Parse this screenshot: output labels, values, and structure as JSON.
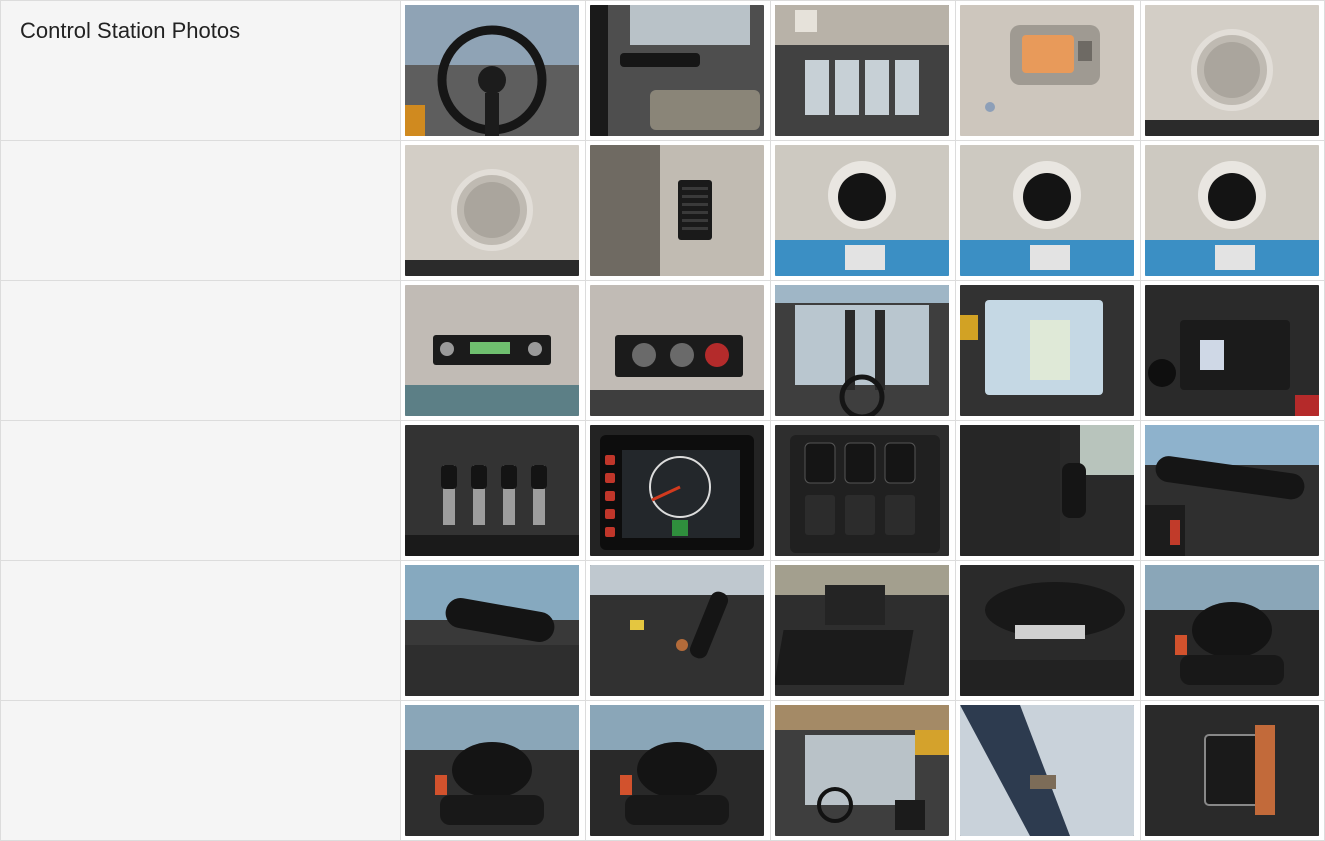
{
  "section": {
    "title": "Control Station Photos"
  },
  "rows": [
    {
      "photos": [
        {
          "icon": "steering-wheel-icon",
          "color": "#5a5a5a"
        },
        {
          "icon": "door-handle-icon",
          "color": "#4a4a4a"
        },
        {
          "icon": "rear-window-icon",
          "color": "#3c3c3c"
        },
        {
          "icon": "dome-light-icon",
          "color": "#c8c2b8"
        },
        {
          "icon": "speaker-icon",
          "color": "#cfcac2"
        }
      ]
    },
    {
      "photos": [
        {
          "icon": "speaker-icon",
          "color": "#cfcac2"
        },
        {
          "icon": "air-vent-icon",
          "color": "#bdb7ae"
        },
        {
          "icon": "ceiling-fan-icon",
          "color": "#c9c4bc"
        },
        {
          "icon": "ceiling-fan-icon",
          "color": "#c9c4bc"
        },
        {
          "icon": "ceiling-fan-icon",
          "color": "#c9c4bc"
        }
      ]
    },
    {
      "photos": [
        {
          "icon": "radio-icon",
          "color": "#bcb7b0"
        },
        {
          "icon": "climate-control-icon",
          "color": "#bcb7b0"
        },
        {
          "icon": "windshield-icon",
          "color": "#3a3a3a"
        },
        {
          "icon": "side-window-icon",
          "color": "#2e2e2e"
        },
        {
          "icon": "storage-tray-icon",
          "color": "#262626"
        }
      ]
    },
    {
      "photos": [
        {
          "icon": "control-levers-icon",
          "color": "#2f2f2f"
        },
        {
          "icon": "dashboard-display-icon",
          "color": "#1f1f1f"
        },
        {
          "icon": "switch-panel-icon",
          "color": "#2a2a2a"
        },
        {
          "icon": "joystick-icon",
          "color": "#242424"
        },
        {
          "icon": "turn-signal-stalk-icon",
          "color": "#2b2b2b"
        }
      ]
    },
    {
      "photos": [
        {
          "icon": "gear-selector-icon",
          "color": "#353535"
        },
        {
          "icon": "parking-brake-icon",
          "color": "#2c2c2c"
        },
        {
          "icon": "floor-mat-icon",
          "color": "#2a2a2a"
        },
        {
          "icon": "seat-base-icon",
          "color": "#262626"
        },
        {
          "icon": "seat-icon",
          "color": "#232323"
        }
      ]
    },
    {
      "photos": [
        {
          "icon": "seat-icon",
          "color": "#2a2a2a"
        },
        {
          "icon": "seat-icon",
          "color": "#252525"
        },
        {
          "icon": "operator-cab-icon",
          "color": "#3a3a3a"
        },
        {
          "icon": "roof-frame-icon",
          "color": "#4a4a4a"
        },
        {
          "icon": "door-hinge-icon",
          "color": "#333333"
        }
      ]
    }
  ]
}
